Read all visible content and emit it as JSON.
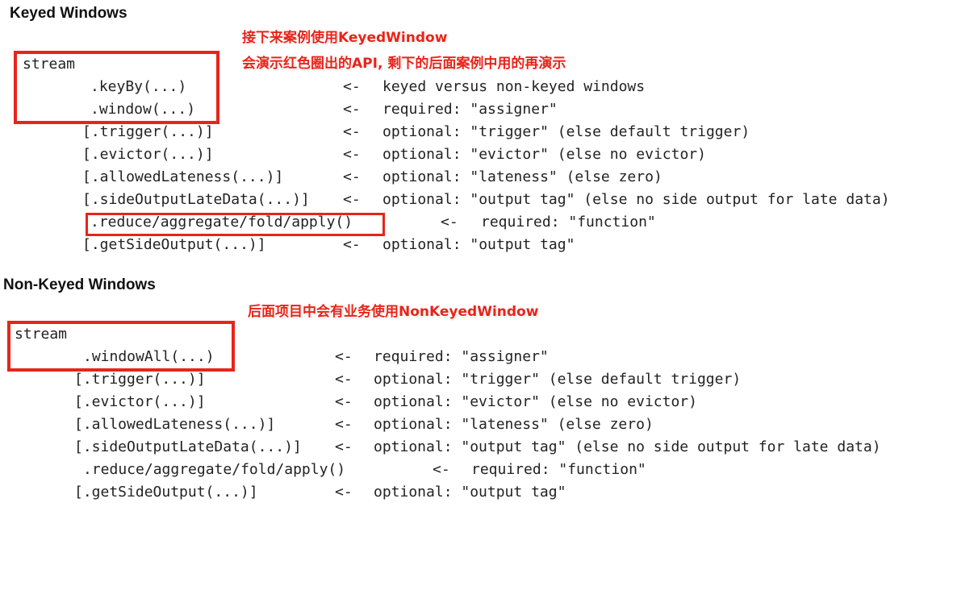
{
  "keyed": {
    "heading": "Keyed Windows",
    "notes": [
      "接下来案例使用KeyedWindow",
      "会演示红色圈出的API, 剩下的后面案例中用的再演示"
    ],
    "lines": [
      {
        "code": "stream",
        "arrow": "",
        "desc": ""
      },
      {
        "code": ".keyBy(...)",
        "arrow": "<-",
        "desc": "keyed versus non-keyed windows"
      },
      {
        "code": ".window(...)",
        "arrow": "<-",
        "desc": "required: \"assigner\""
      },
      {
        "code": "[.trigger(...)]",
        "arrow": "<-",
        "desc": "optional: \"trigger\" (else default trigger)"
      },
      {
        "code": "[.evictor(...)]",
        "arrow": "<-",
        "desc": "optional: \"evictor\" (else no evictor)"
      },
      {
        "code": "[.allowedLateness(...)]",
        "arrow": "<-",
        "desc": "optional: \"lateness\" (else zero)"
      },
      {
        "code": "[.sideOutputLateData(...)]",
        "arrow": "<-",
        "desc": "optional: \"output tag\" (else no side output for late data)"
      },
      {
        "code": ".reduce/aggregate/fold/apply()",
        "arrow": "<-",
        "desc": "required: \"function\""
      },
      {
        "code": "[.getSideOutput(...)]",
        "arrow": "<-",
        "desc": "optional: \"output tag\""
      }
    ]
  },
  "non_keyed": {
    "heading": "Non-Keyed Windows",
    "notes": [
      "后面项目中会有业务使用NonKeyedWindow"
    ],
    "lines": [
      {
        "code": "stream",
        "arrow": "",
        "desc": ""
      },
      {
        "code": ".windowAll(...)",
        "arrow": "<-",
        "desc": "required: \"assigner\""
      },
      {
        "code": "[.trigger(...)]",
        "arrow": "<-",
        "desc": "optional: \"trigger\" (else default trigger)"
      },
      {
        "code": "[.evictor(...)]",
        "arrow": "<-",
        "desc": "optional: \"evictor\" (else no evictor)"
      },
      {
        "code": "[.allowedLateness(...)]",
        "arrow": "<-",
        "desc": "optional: \"lateness\" (else zero)"
      },
      {
        "code": "[.sideOutputLateData(...)]",
        "arrow": "<-",
        "desc": "optional: \"output tag\" (else no side output for late data)"
      },
      {
        "code": ".reduce/aggregate/fold/apply()",
        "arrow": "<-",
        "desc": "required: \"function\""
      },
      {
        "code": "[.getSideOutput(...)]",
        "arrow": "<-",
        "desc": "optional: \"output tag\""
      }
    ]
  }
}
